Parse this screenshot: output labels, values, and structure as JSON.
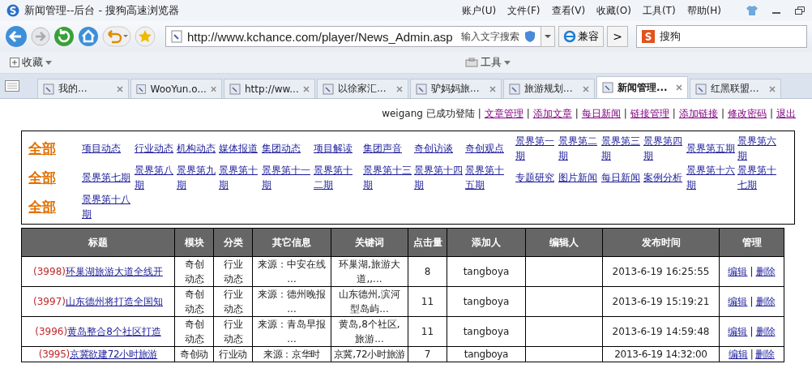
{
  "window": {
    "title": "新闻管理--后台 - 搜狗高速浏览器",
    "menu": [
      "账户(U)",
      "文件(F)",
      "查看(V)",
      "收藏(O)",
      "工具(T)",
      "帮助(H)"
    ]
  },
  "address_bar": {
    "url": "http://www.kchance.com/player/News_Admin.asp",
    "search_hint": "输入文字搜索",
    "compat_button": "兼容",
    "next_button": ">"
  },
  "search_box": {
    "value": "搜狗"
  },
  "bookmarks_bar": {
    "favorites": "收藏",
    "tools": "工具"
  },
  "tabs": [
    {
      "label": "我的...",
      "selected": false
    },
    {
      "label": "WooYun.o...",
      "selected": false
    },
    {
      "label": "http://ww...",
      "selected": false
    },
    {
      "label": "以徐家汇...",
      "selected": false
    },
    {
      "label": "驴妈妈旅...",
      "selected": false
    },
    {
      "label": "旅游规划...",
      "selected": false
    },
    {
      "label": "新闻管理...",
      "selected": true
    },
    {
      "label": "红黑联盟...",
      "selected": false
    }
  ],
  "login_bar": {
    "status": "weigang 已成功登陆",
    "separator": "|",
    "links": [
      "文章管理",
      "添加文章",
      "每日新闻",
      "链接管理",
      "添加链接",
      "修改密码",
      "退出"
    ]
  },
  "category_rows": [
    {
      "all": "全部",
      "links": [
        "项目动态",
        "行业动态",
        "机构动态",
        "媒体报道",
        "集团动态",
        "项目解读",
        "集团声音",
        "奇创访谈",
        "奇创观点",
        "景界第一期",
        "景界第二期",
        "景界第三期",
        "景界第四期",
        "景界第五期",
        "景界第六期"
      ]
    },
    {
      "all": "全部",
      "links": [
        "景界第七期",
        "景界第八期",
        "景界第九期",
        "景界第十期",
        "景界第十一期",
        "景界第十二期",
        "景界第十三期",
        "景界第十四期",
        "景界第十五期",
        "专题研究",
        "图片新闻",
        "每日新闻",
        "案例分析",
        "景界第十六期",
        "景界第十七期"
      ]
    },
    {
      "all": "全部",
      "links": [
        "景界第十八期"
      ]
    }
  ],
  "table": {
    "columns": [
      "标题",
      "模块",
      "分类",
      "其它信息",
      "关键词",
      "点击量",
      "添加人",
      "编辑人",
      "发布时间",
      "管理"
    ],
    "rows": [
      {
        "number": "(3998)",
        "title": "环巢湖旅游大道全线开",
        "module": "奇创动态",
        "category": "行业动态",
        "other_info": "来源：中安在线 ...",
        "keywords": "环巢湖,旅游大道,,...",
        "clicks": "8",
        "added_by": "tangboya",
        "published": "2013-6-19 16:25:55",
        "edit": "编辑",
        "separator": "|",
        "delete": "删除"
      },
      {
        "number": "(3997)",
        "title": "山东德州将打造全国知",
        "module": "奇创动态",
        "category": "行业动态",
        "other_info": "来源：德州晚报 ...",
        "keywords": "山东德州,滨河型岛屿...",
        "clicks": "11",
        "added_by": "tangboya",
        "published": "2013-6-19 15:19:21",
        "edit": "编辑",
        "separator": "|",
        "delete": "删除"
      },
      {
        "number": "(3996)",
        "title": "黄岛整合8个社区打造",
        "module": "奇创动态",
        "category": "行业动态",
        "other_info": "来源：青岛早报 ...",
        "keywords": "黄岛,8个社区,旅游...",
        "clicks": "11",
        "added_by": "tangboya",
        "published": "2013-6-19 14:59:48",
        "edit": "编辑",
        "separator": "|",
        "delete": "删除"
      },
      {
        "number": "(3995)",
        "title": "京冀欲建72小时旅游",
        "module": "奇创动",
        "category": "行业动",
        "other_info": "来源：京华时",
        "keywords": "京冀,72小时旅游",
        "clicks": "7",
        "added_by": "tangboya",
        "published": "2013-6-19 14:32:00",
        "edit": "编辑",
        "separator": "|",
        "delete": "删除"
      }
    ]
  }
}
